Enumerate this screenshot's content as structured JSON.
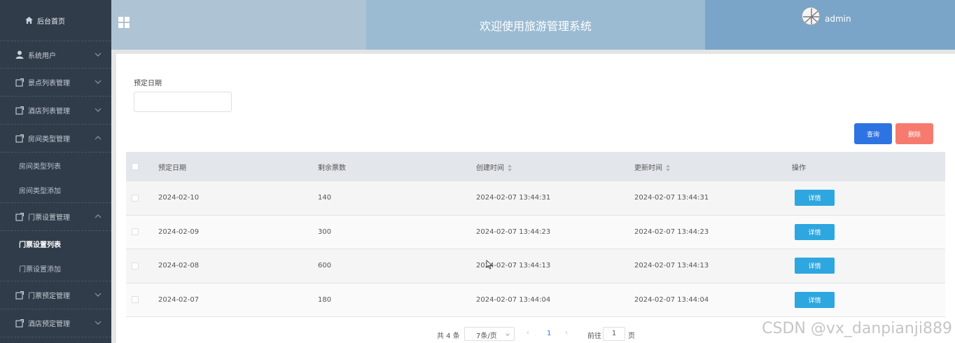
{
  "sidebar": {
    "home_label": "后台首页",
    "groups": [
      {
        "label": "系统用户"
      },
      {
        "label": "景点列表管理"
      },
      {
        "label": "酒店列表管理"
      },
      {
        "label": "房间类型管理"
      },
      {
        "label": "门票设置管理"
      },
      {
        "label": "门票预定管理"
      },
      {
        "label": "酒店预定管理"
      }
    ],
    "subitems": {
      "room": [
        "房间类型列表",
        "房间类型添加"
      ],
      "ticket": [
        "门票设置列表",
        "门票设置添加"
      ]
    }
  },
  "header": {
    "title": "欢迎使用旅游管理系统",
    "user": "admin"
  },
  "search": {
    "label": "预定日期",
    "placeholder": ""
  },
  "buttons": {
    "query": "查询",
    "delete": "删除"
  },
  "table": {
    "headers": [
      "预定日期",
      "剩余票数",
      "创建时间",
      "更新时间",
      "操作"
    ],
    "rows": [
      {
        "date": "2024-02-10",
        "remaining": "140",
        "created": "2024-02-07 13:44:31",
        "updated": "2024-02-07 13:44:31",
        "action": "详情"
      },
      {
        "date": "2024-02-09",
        "remaining": "300",
        "created": "2024-02-07 13:44:23",
        "updated": "2024-02-07 13:44:23",
        "action": "详情"
      },
      {
        "date": "2024-02-08",
        "remaining": "600",
        "created": "2024-02-07 13:44:13",
        "updated": "2024-02-07 13:44:13",
        "action": "详情"
      },
      {
        "date": "2024-02-07",
        "remaining": "180",
        "created": "2024-02-07 13:44:04",
        "updated": "2024-02-07 13:44:04",
        "action": "详情"
      }
    ]
  },
  "pagination": {
    "total": "共 4 条",
    "page_size": "7条/页",
    "current_page": "1",
    "goto_label": "前往",
    "goto_value": "1",
    "page_suffix": "页"
  },
  "watermark": "CSDN @vx_danpianji889",
  "colors": {
    "sidebar_bg": "#313c4a",
    "primary": "#2e73e2",
    "danger": "#f77a6f",
    "detail": "#2ea7e0"
  }
}
